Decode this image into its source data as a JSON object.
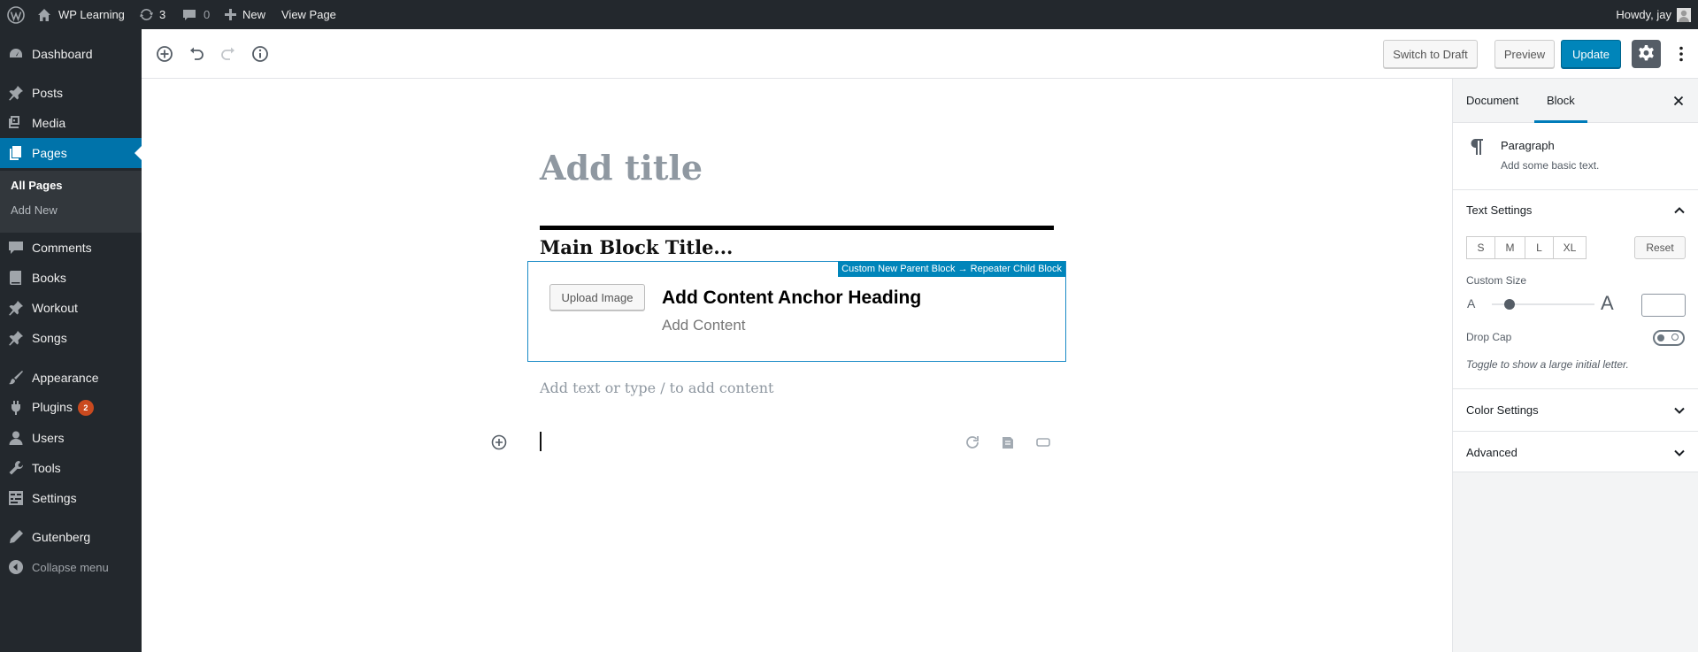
{
  "admin_bar": {
    "site_name": "WP Learning",
    "updates_count": "3",
    "comments_count": "0",
    "new_label": "New",
    "view_page_label": "View Page",
    "howdy": "Howdy, jay"
  },
  "sidebar": {
    "items": [
      {
        "label": "Dashboard",
        "icon": "dashboard-icon"
      },
      {
        "label": "Posts",
        "icon": "pin-icon"
      },
      {
        "label": "Media",
        "icon": "media-icon"
      },
      {
        "label": "Pages",
        "icon": "pages-icon"
      },
      {
        "label": "Comments",
        "icon": "comment-icon"
      },
      {
        "label": "Books",
        "icon": "book-icon"
      },
      {
        "label": "Workout",
        "icon": "pin-icon"
      },
      {
        "label": "Songs",
        "icon": "pin-icon"
      },
      {
        "label": "Appearance",
        "icon": "brush-icon"
      },
      {
        "label": "Plugins",
        "icon": "plug-icon",
        "badge": "2"
      },
      {
        "label": "Users",
        "icon": "user-icon"
      },
      {
        "label": "Tools",
        "icon": "wrench-icon"
      },
      {
        "label": "Settings",
        "icon": "settings-icon"
      },
      {
        "label": "Gutenberg",
        "icon": "pencil-icon"
      }
    ],
    "submenu": {
      "all_pages": "All Pages",
      "add_new": "Add New"
    },
    "collapse_label": "Collapse menu"
  },
  "toolbar": {
    "switch_to_draft": "Switch to Draft",
    "preview": "Preview",
    "update": "Update"
  },
  "editor": {
    "title_placeholder": "Add title",
    "main_block_title": "Main Block Title...",
    "child_block_label": "Custom New Parent Block → Repeater Child Block",
    "upload_image": "Upload Image",
    "anchor_heading": "Add Content Anchor Heading",
    "add_content": "Add Content",
    "paragraph_placeholder": "Add text or type / to add content"
  },
  "inspector": {
    "tabs": [
      "Document",
      "Block"
    ],
    "active_tab": "Block",
    "block_name": "Paragraph",
    "block_description": "Add some basic text.",
    "text_settings_title": "Text Settings",
    "size_buttons": [
      "S",
      "M",
      "L",
      "XL"
    ],
    "reset_label": "Reset",
    "custom_size_label": "Custom Size",
    "small_a": "A",
    "large_a": "A",
    "drop_cap_label": "Drop Cap",
    "drop_cap_help": "Toggle to show a large initial letter.",
    "color_settings_title": "Color Settings",
    "advanced_title": "Advanced"
  },
  "colors": {
    "admin_dark": "#23282d",
    "accent_blue": "#0085ba",
    "active_menu": "#0073aa",
    "badge_orange": "#ca4a1f"
  }
}
